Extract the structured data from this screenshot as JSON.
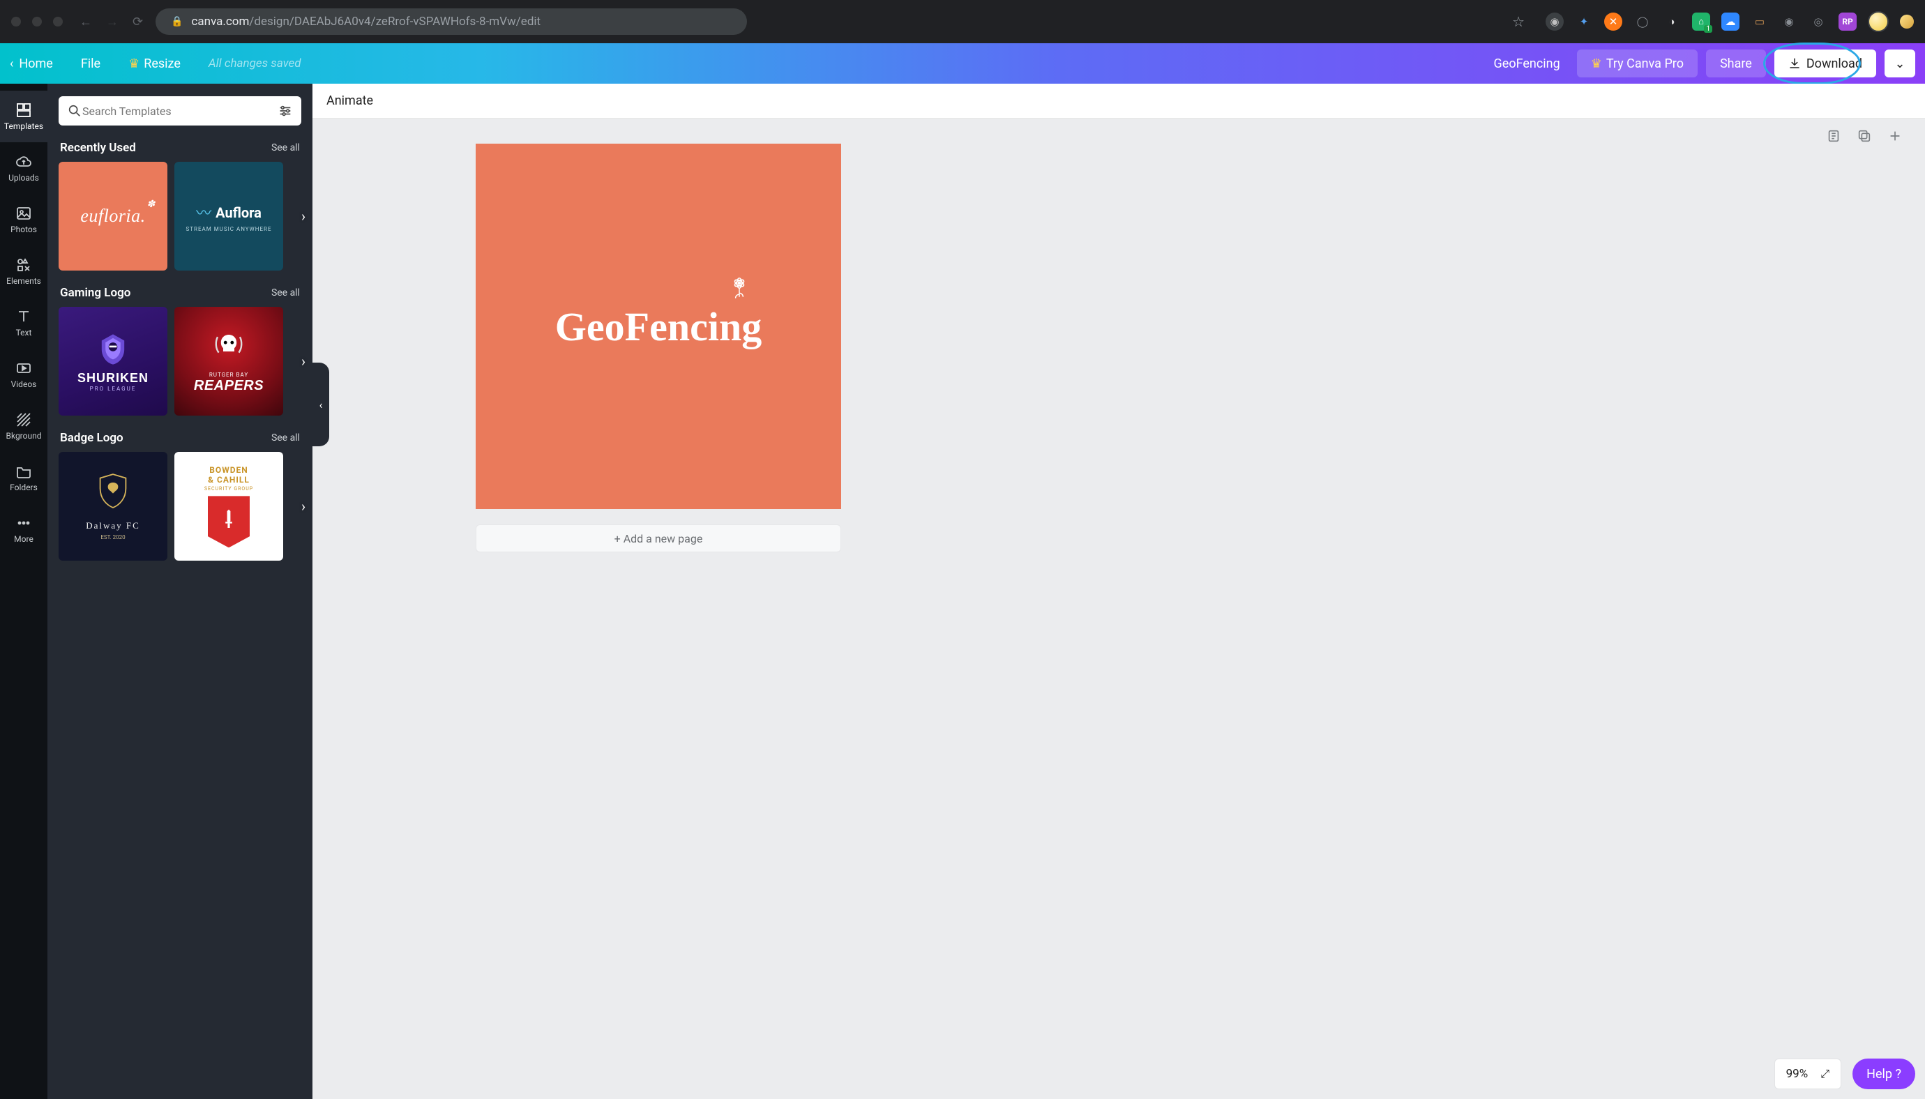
{
  "browser": {
    "url_host": "canva.com",
    "url_path": "/design/DAEAbJ6A0v4/zeRrof-vSPAWHofs-8-mVw/edit"
  },
  "topbar": {
    "home": "Home",
    "file": "File",
    "resize": "Resize",
    "saved": "All changes saved",
    "title": "GeoFencing",
    "try_pro": "Try Canva Pro",
    "share": "Share",
    "download": "Download"
  },
  "subheader": {
    "animate": "Animate"
  },
  "nav": {
    "templates": "Templates",
    "uploads": "Uploads",
    "photos": "Photos",
    "elements": "Elements",
    "text": "Text",
    "videos": "Videos",
    "bkground": "Bkground",
    "folders": "Folders",
    "more": "More"
  },
  "search": {
    "placeholder": "Search Templates"
  },
  "sections": {
    "recently": {
      "title": "Recently Used",
      "see_all": "See all",
      "items": [
        {
          "name": "eufloria.",
          "sub": ""
        },
        {
          "name": "Auflora",
          "sub": "STREAM MUSIC ANYWHERE"
        }
      ]
    },
    "gaming": {
      "title": "Gaming Logo",
      "see_all": "See all",
      "items": [
        {
          "line1": "SHURIKEN",
          "line2": "PRO LEAGUE"
        },
        {
          "line1": "RUTGER BAY",
          "line2": "REAPERS"
        }
      ]
    },
    "badge": {
      "title": "Badge Logo",
      "see_all": "See all",
      "items": [
        {
          "line1": "Dalway FC",
          "line2": "EST. 2020"
        },
        {
          "line1": "BOWDEN & CAHILL",
          "line2": "SECURITY GROUP"
        }
      ]
    }
  },
  "canvas": {
    "logo_text": "GeoFencing",
    "add_page": "+ Add a new page"
  },
  "footer": {
    "zoom": "99%",
    "help": "Help  ?"
  }
}
